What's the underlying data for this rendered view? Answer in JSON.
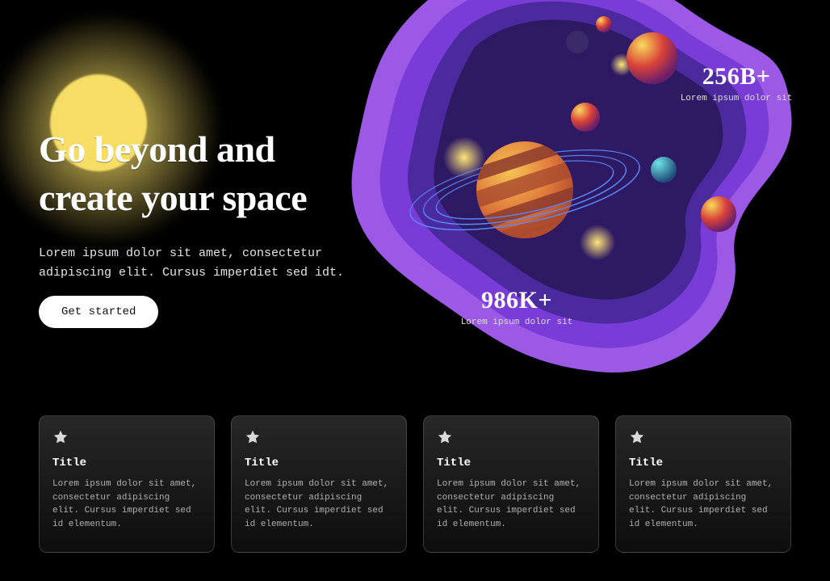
{
  "hero": {
    "title_line1": "Go beyond and",
    "title_line2": "create your space",
    "subtitle": "Lorem ipsum dolor sit amet, consectetur adipiscing elit. Cursus imperdiet sed idt.",
    "cta_label": "Get started"
  },
  "stats": {
    "a": {
      "value": "256B+",
      "label": "Lorem ipsum dolor sit"
    },
    "b": {
      "value": "986K+",
      "label": "Lorem ipsum dolor sit"
    }
  },
  "cards": [
    {
      "title": "Title",
      "desc": "Lorem ipsum dolor sit amet, consectetur adipiscing elit. Cursus imperdiet sed id elementum."
    },
    {
      "title": "Title",
      "desc": "Lorem ipsum dolor sit amet, consectetur adipiscing elit. Cursus imperdiet sed id elementum."
    },
    {
      "title": "Title",
      "desc": "Lorem ipsum dolor sit amet, consectetur adipiscing elit. Cursus imperdiet sed id elementum."
    },
    {
      "title": "Title",
      "desc": "Lorem ipsum dolor sit amet, consectetur adipiscing elit. Cursus imperdiet sed id elementum."
    }
  ]
}
